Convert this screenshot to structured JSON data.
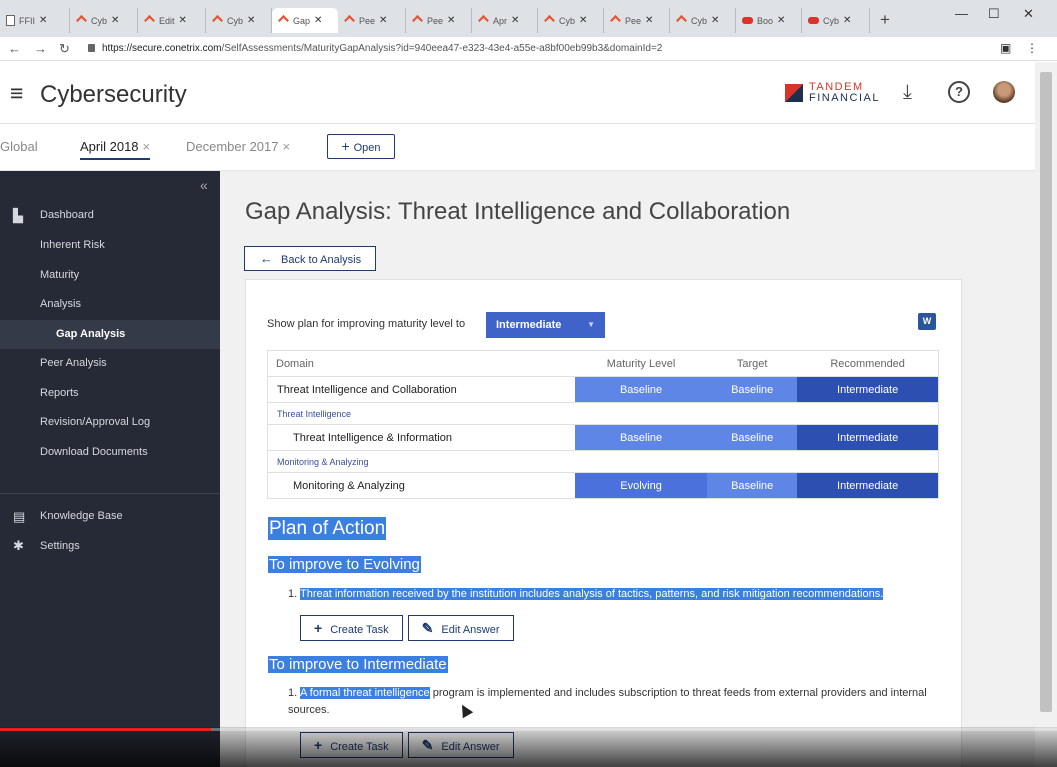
{
  "browser": {
    "tabs": [
      {
        "label": "FFII",
        "icon": "doc-icon"
      },
      {
        "label": "Cyb",
        "icon": "conetrix-icon"
      },
      {
        "label": "Edit",
        "icon": "conetrix-icon"
      },
      {
        "label": "Cyb",
        "icon": "conetrix-icon"
      },
      {
        "label": "Gap",
        "icon": "conetrix-icon",
        "active": true
      },
      {
        "label": "Pee",
        "icon": "conetrix-icon"
      },
      {
        "label": "Pee",
        "icon": "conetrix-icon"
      },
      {
        "label": "Apr",
        "icon": "conetrix-icon"
      },
      {
        "label": "Cyb",
        "icon": "conetrix-icon"
      },
      {
        "label": "Pee",
        "icon": "conetrix-icon"
      },
      {
        "label": "Cyb",
        "icon": "conetrix-icon"
      },
      {
        "label": "Boo",
        "icon": "bo-icon"
      },
      {
        "label": "Cyb",
        "icon": "bo-icon"
      }
    ],
    "url_host": "https://secure.conetrix.com",
    "url_path": "/SelfAssessments/MaturityGapAnalysis?id=940eea47-e323-43e4-a55e-a8bf00eb99b3&domainId=2"
  },
  "header": {
    "title": "Cybersecurity",
    "logo_line1": "TANDEM",
    "logo_line2": "FINANCIAL"
  },
  "assessment_tabs": {
    "global": "Global",
    "tab1": "April 2018",
    "tab2": "December 2017",
    "close": "×",
    "open_label": "Open",
    "open_icon": "+"
  },
  "sidebar": {
    "dashboard": "Dashboard",
    "inherent_risk": "Inherent Risk",
    "maturity": "Maturity",
    "analysis": "Analysis",
    "gap_analysis": "Gap Analysis",
    "peer_analysis": "Peer Analysis",
    "reports": "Reports",
    "revision_log": "Revision/Approval Log",
    "download_documents": "Download Documents",
    "knowledge_base": "Knowledge Base",
    "settings": "Settings"
  },
  "main": {
    "title": "Gap Analysis: Threat Intelligence and Collaboration",
    "back_label": "Back to Analysis",
    "show_plan_label": "Show plan for improving maturity level to",
    "selected_level": "Intermediate",
    "table": {
      "headers": [
        "Domain",
        "Maturity Level",
        "Target",
        "Recommended"
      ],
      "rows": [
        {
          "domain": "Threat Intelligence and Collaboration",
          "maturity": "Baseline",
          "target": "Baseline",
          "recommended": "Intermediate"
        },
        {
          "section": "Threat Intelligence"
        },
        {
          "domain": "Threat Intelligence & Information",
          "maturity": "Baseline",
          "target": "Baseline",
          "recommended": "Intermediate"
        },
        {
          "section": "Monitoring & Analyzing"
        },
        {
          "domain": "Monitoring & Analyzing",
          "maturity": "Evolving",
          "target": "Baseline",
          "recommended": "Intermediate"
        }
      ]
    },
    "plan_title": "Plan of Action",
    "improve_evolving": "To improve to Evolving",
    "evolving_item_num": "1.",
    "evolving_item": "Threat information received by the institution includes analysis of tactics, patterns, and risk mitigation recommendations.",
    "improve_intermediate": "To improve to Intermediate",
    "intermediate_item_num": "1.",
    "intermediate_item_highlight": "A formal threat intelligence",
    "intermediate_item_rest": " program is implemented and includes subscription to threat feeds from external providers and internal sources.",
    "create_task": "Create Task",
    "edit_answer": "Edit Answer"
  },
  "colors": {
    "sidebar_bg": "#262a36",
    "accent": "#3f63c8",
    "highlight": "#3b7fe0",
    "video_progress": "#e62117"
  },
  "video": {
    "progress": 0.2
  }
}
